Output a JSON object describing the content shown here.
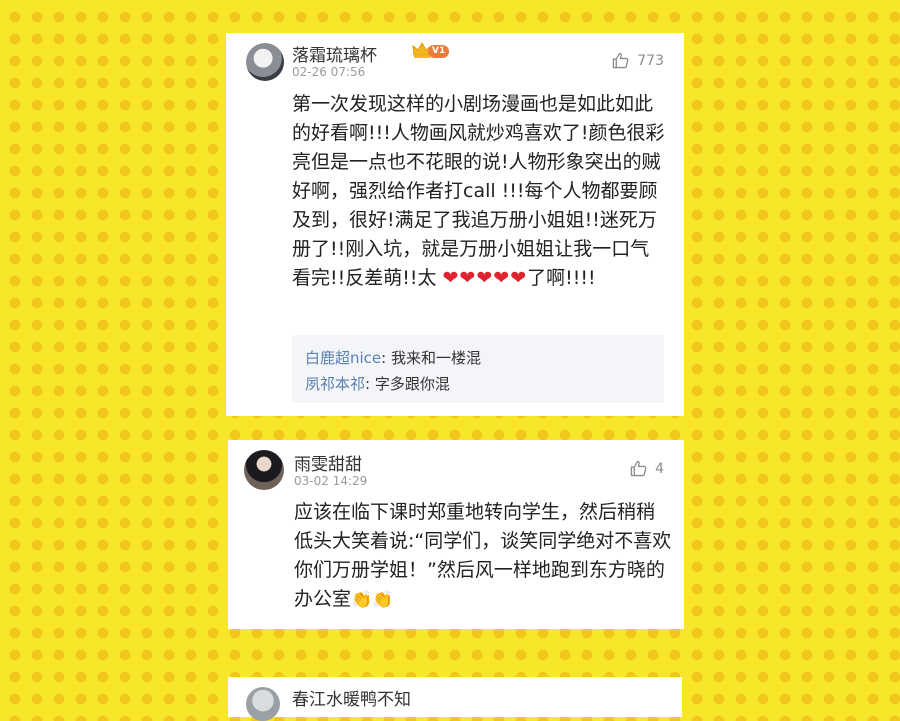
{
  "comments": [
    {
      "username": "落霜琉璃杯",
      "vip_badge": "V1",
      "date": "02-26 07:56",
      "likes": "773",
      "text": "第一次发现这样的小剧场漫画也是如此如此的好看啊!!!人物画风就炒鸡喜欢了!颜色很彩亮但是一点也不花眼的说!人物形象突出的贼好啊，强烈给作者打call !!!每个人物都要顾及到，很好!满足了我追万册小姐姐!!迷死万册了!!刚入坑，就是万册小姐姐让我一口气看完!!反差萌!!太 ",
      "hearts": "❤❤❤❤❤",
      "text_end": "了啊!!!!",
      "replies": [
        {
          "user": "白鹿超nice",
          "text": ": 我来和一楼混"
        },
        {
          "user": "夙祁本祁",
          "text": ": 字多跟你混"
        }
      ]
    },
    {
      "username": "雨雯甜甜",
      "date": "03-02 14:29",
      "likes": "4",
      "text": "应该在临下课时郑重地转向学生，然后稍稍低头大笑着说:“同学们，谈笑同学绝对不喜欢你们万册学姐！”然后风一样地跑到东方晓的办公室",
      "emoji": "👏👏"
    },
    {
      "username": "春江水暖鸭不知"
    }
  ],
  "colors": {
    "background": "#f7e62a",
    "dots": "#f2c71c",
    "reply_user": "#5b80b2",
    "vip_badge": "#ec7b3a",
    "heart": "#e0242e"
  }
}
